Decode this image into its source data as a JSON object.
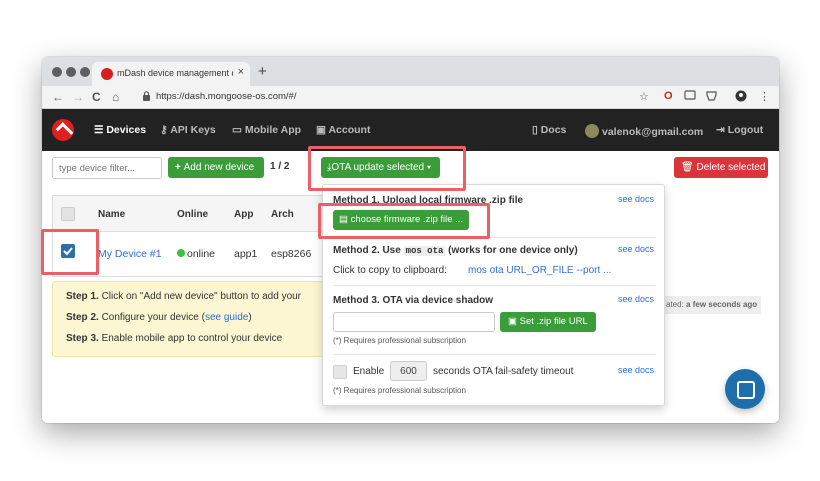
{
  "browser": {
    "tab_title": "mDash device management da",
    "tab_close": "×",
    "new_tab": "+",
    "url": "https://dash.mongoose-os.com/#/",
    "back": "←",
    "forward": "→",
    "reload": "C",
    "home": "⌂",
    "star": "☆",
    "menu": "⋮"
  },
  "nav": {
    "devices": "Devices",
    "api_keys": "API Keys",
    "mobile_app": "Mobile App",
    "account": "Account",
    "docs": "Docs",
    "user": "valenok@gmail.com",
    "logout": "Logout"
  },
  "toolbar": {
    "filter_placeholder": "type device filter...",
    "add_device": "Add new device",
    "count": "1 / 2",
    "ota_button": "OTA update selected",
    "delete_selected": "Delete selected"
  },
  "table": {
    "headers": [
      "Name",
      "Online",
      "App",
      "Arch"
    ],
    "row": {
      "name": "My Device #1",
      "online": "online",
      "app": "app1",
      "arch": "esp8266",
      "updated_label": "ated:",
      "updated_value": "a few seconds ago"
    }
  },
  "steps": [
    {
      "label": "Step 1.",
      "text": "Click on \"Add new device\" button to add your"
    },
    {
      "label": "Step 2.",
      "text": "Configure your device (",
      "link": "see guide",
      "tail": ")"
    },
    {
      "label": "Step 3.",
      "text": "Enable mobile app to control your device"
    }
  ],
  "ota": {
    "method1": "Method 1. Upload local firmware .zip file",
    "choose_button": "choose firmware .zip file ...",
    "method2_prefix": "Method 2. Use",
    "method2_code": "mos ota",
    "method2_suffix": "(works for one device only)",
    "clipboard_label": "Click to copy to clipboard:",
    "clipboard_cmd": "mos ota URL_OR_FILE --port ...",
    "method3": "Method 3. OTA via device shadow",
    "set_url_button": "Set .zip file URL",
    "pro_note": "(*) Requires professional subscription",
    "enable_label": "Enable",
    "timeout_value": "600",
    "timeout_label": "seconds OTA fail-safety timeout",
    "see_docs": "see docs"
  },
  "colors": {
    "accent_green": "#3a9d3a",
    "danger_red": "#d9353c",
    "highlight": "#ec5f66",
    "link_blue": "#2d6fd8"
  }
}
